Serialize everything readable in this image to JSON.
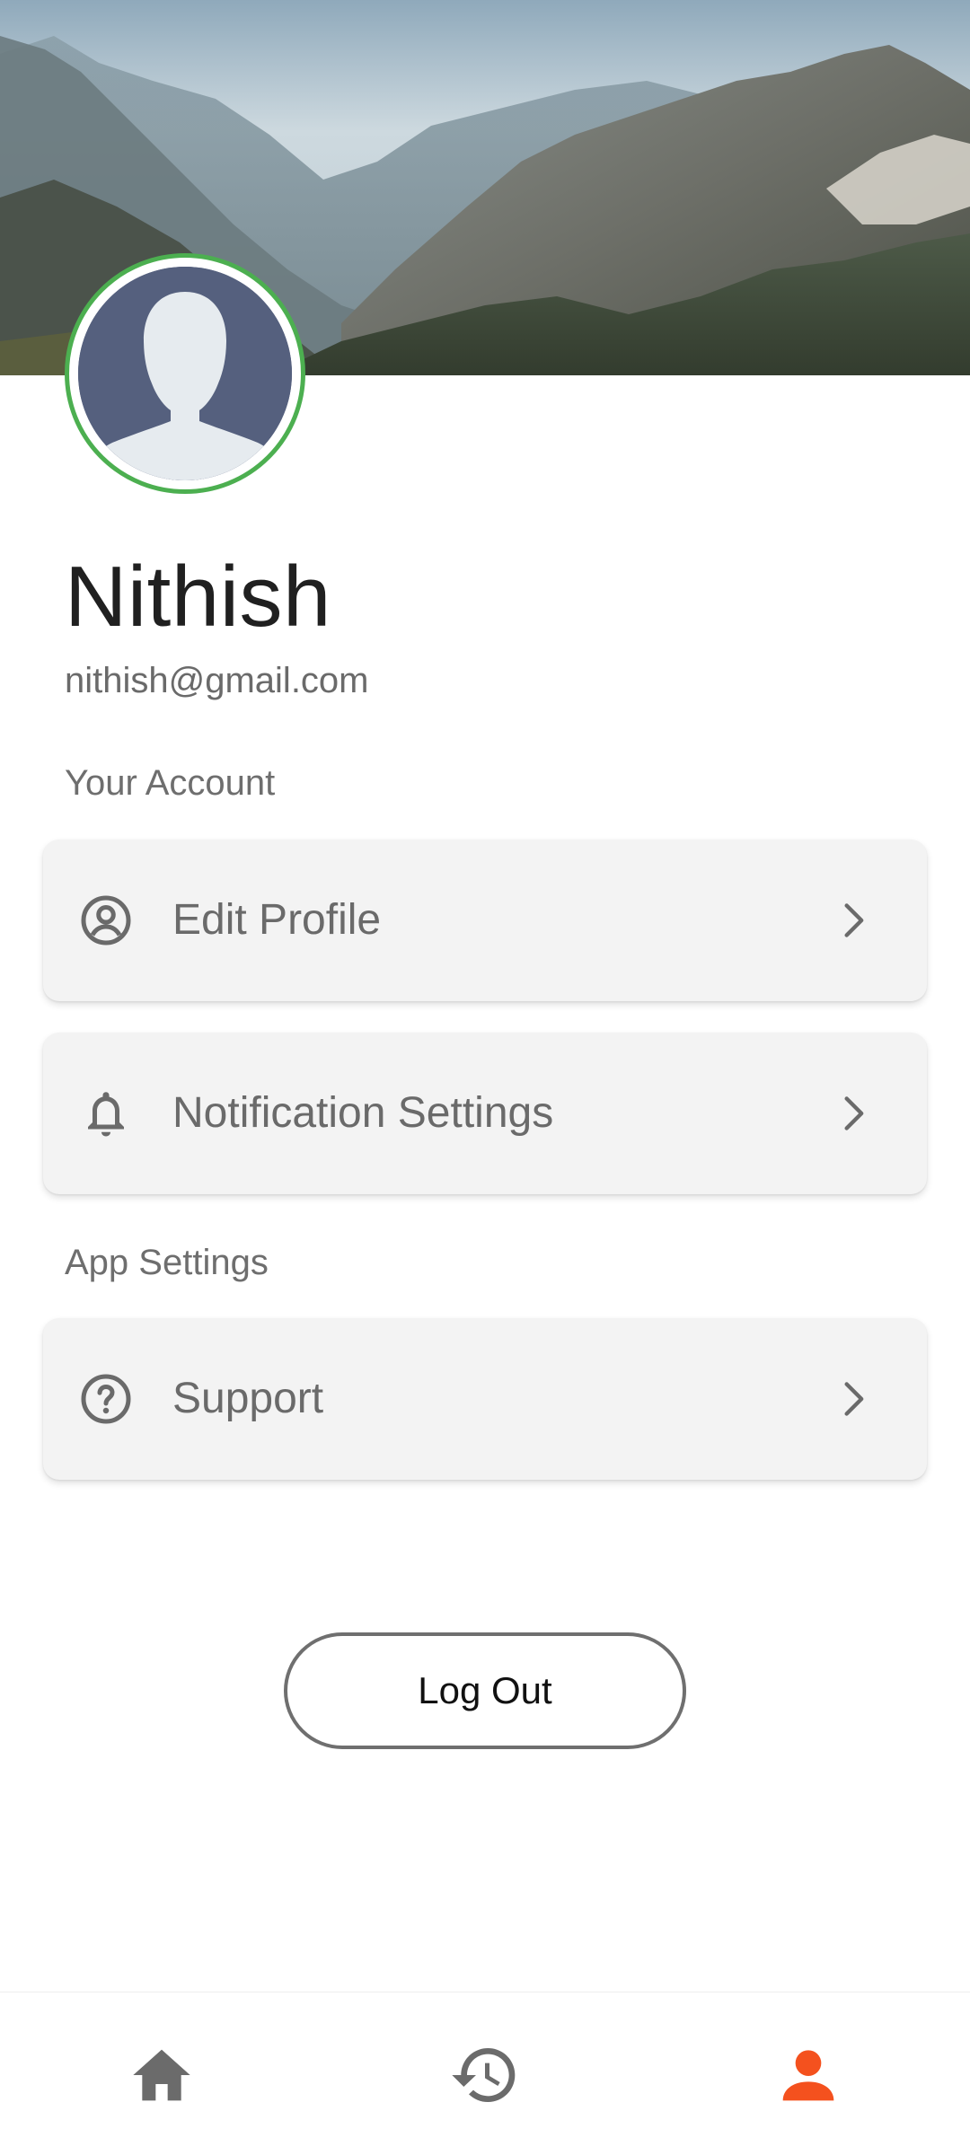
{
  "profile": {
    "name": "Nithish",
    "email": "nithish@gmail.com"
  },
  "sections": {
    "account": "Your Account",
    "app": "App Settings"
  },
  "menu": {
    "edit_profile": "Edit Profile",
    "notification_settings": "Notification Settings",
    "support": "Support"
  },
  "actions": {
    "logout": "Log Out"
  },
  "icons": {
    "edit_profile": "account-circle-icon",
    "notification_settings": "bell-icon",
    "support": "help-circle-icon",
    "chevron": "chevron-right-icon",
    "nav_home": "home-icon",
    "nav_history": "history-icon",
    "nav_profile": "person-icon"
  },
  "colors": {
    "avatar_ring": "#4caf50",
    "active_nav": "#f4511e",
    "inactive_nav": "#6b6b6b"
  },
  "bottom_nav": {
    "active": "profile"
  }
}
